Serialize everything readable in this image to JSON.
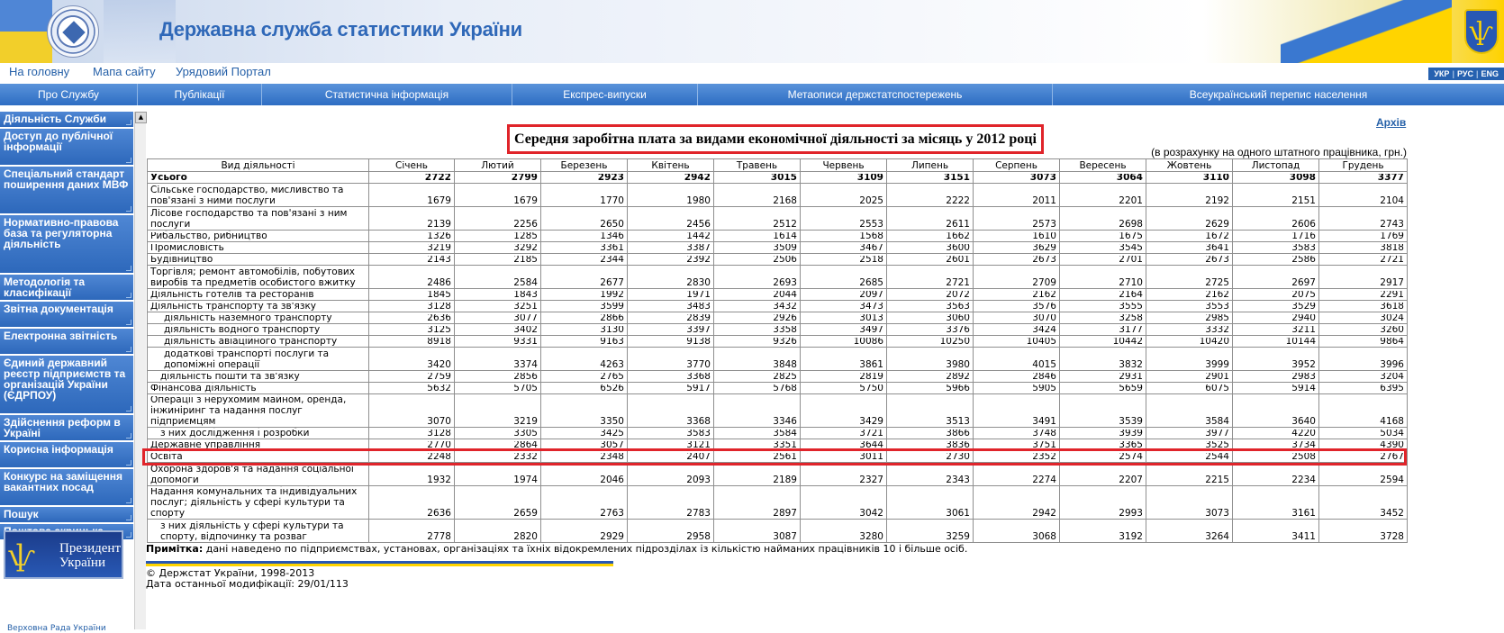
{
  "header": {
    "title": "Державна служба статистики України"
  },
  "toplinks": [
    "На головну",
    "Мапа сайту",
    "Урядовий Портал"
  ],
  "lang": [
    "УКР",
    "РУС",
    "ENG"
  ],
  "mainnav": [
    "Про Службу",
    "Публікації",
    "Статистична інформація",
    "Експрес-випуски",
    "Метаописи держстатспостережень",
    "Всеукраїнський перепис населення"
  ],
  "sidebar": [
    "Діяльність Служби",
    "Доступ до публічної інформації",
    "Спеціальний стандарт поширення даних МВФ",
    "Нормативно-правова база та регуляторна діяльність",
    "Методологія та класифікації",
    "Звітна документація",
    "Електронна звітність",
    "Єдиний державний реєстр підприємств та організацій України (ЄДРПОУ)",
    "Здійснення реформ в Україні",
    "Корисна інформація",
    "Конкурс на заміщення вакантних посад",
    "Пошук",
    "Поштова скринька"
  ],
  "banner": {
    "line1": "Президент",
    "line2": "України",
    "cut": "Верховна Рада України"
  },
  "archive": "Архів",
  "page_title": "Середня заробітна плата за видами економічної діяльності за місяць у 2012 році",
  "units": "(в розрахунку на одного штатного працівника, грн.)",
  "table": {
    "headers": [
      "Вид діяльності",
      "Січень",
      "Лютий",
      "Березень",
      "Квітень",
      "Травень",
      "Червень",
      "Липень",
      "Серпень",
      "Вересень",
      "Жовтень",
      "Листопад",
      "Грудень"
    ],
    "rows": [
      {
        "label": "Усього",
        "v": [
          2722,
          2799,
          2923,
          2942,
          3015,
          3109,
          3151,
          3073,
          3064,
          3110,
          3098,
          3377
        ]
      },
      {
        "label": "Сільське господарство, мисливство та пов'язані з ними послуги",
        "v": [
          1679,
          1679,
          1770,
          1980,
          2168,
          2025,
          2222,
          2011,
          2201,
          2192,
          2151,
          2104
        ]
      },
      {
        "label": "Лісове господарство та пов'язані з ним послуги",
        "v": [
          2139,
          2256,
          2650,
          2456,
          2512,
          2553,
          2611,
          2573,
          2698,
          2629,
          2606,
          2743
        ]
      },
      {
        "label": "Рибальство, рибництво",
        "v": [
          1326,
          1285,
          1346,
          1442,
          1614,
          1568,
          1662,
          1610,
          1675,
          1672,
          1716,
          1769
        ]
      },
      {
        "label": "Промисловість",
        "v": [
          3219,
          3292,
          3361,
          3387,
          3509,
          3467,
          3600,
          3629,
          3545,
          3641,
          3583,
          3818
        ]
      },
      {
        "label": "Будівництво",
        "v": [
          2143,
          2185,
          2344,
          2392,
          2506,
          2518,
          2601,
          2673,
          2701,
          2673,
          2586,
          2721
        ]
      },
      {
        "label": "Торгівля; ремонт автомобілів, побутових виробів та предметів особистого вжитку",
        "v": [
          2486,
          2584,
          2677,
          2830,
          2693,
          2685,
          2721,
          2709,
          2710,
          2725,
          2697,
          2917
        ]
      },
      {
        "label": "Діяльність готелів та ресторанів",
        "v": [
          1845,
          1843,
          1992,
          1971,
          2044,
          2097,
          2072,
          2162,
          2164,
          2162,
          2075,
          2291
        ]
      },
      {
        "label": "Діяльність транспорту та зв'язку",
        "v": [
          3128,
          3251,
          3599,
          3483,
          3432,
          3473,
          3563,
          3576,
          3555,
          3553,
          3529,
          3618
        ]
      },
      {
        "label": "діяльність наземного транспорту",
        "v": [
          2636,
          3077,
          2866,
          2839,
          2926,
          3013,
          3060,
          3070,
          3258,
          2985,
          2940,
          3024
        ]
      },
      {
        "label": "діяльність водного транспорту",
        "v": [
          3125,
          3402,
          3130,
          3397,
          3358,
          3497,
          3376,
          3424,
          3177,
          3332,
          3211,
          3260
        ]
      },
      {
        "label": "діяльність авіаційного транспорту",
        "v": [
          8918,
          9331,
          9163,
          9138,
          9326,
          10086,
          10250,
          10405,
          10442,
          10420,
          10144,
          9864
        ]
      },
      {
        "label": "додаткові транспорті послуги та допоміжні операції",
        "v": [
          3420,
          3374,
          4263,
          3770,
          3848,
          3861,
          3980,
          4015,
          3832,
          3999,
          3952,
          3996
        ]
      },
      {
        "label": "діяльність пошти та зв'язку",
        "v": [
          2759,
          2856,
          2765,
          3368,
          2825,
          2819,
          2892,
          2846,
          2931,
          2901,
          2983,
          3204
        ]
      },
      {
        "label": "Фінансова діяльність",
        "v": [
          5632,
          5705,
          6526,
          5917,
          5768,
          5750,
          5966,
          5905,
          5659,
          6075,
          5914,
          6395
        ]
      },
      {
        "label": "Операції з нерухомим майном, оренда, інжиніринг та надання послуг підприємцям",
        "v": [
          3070,
          3219,
          3350,
          3368,
          3346,
          3429,
          3513,
          3491,
          3539,
          3584,
          3640,
          4168
        ]
      },
      {
        "label": "з них дослідження і розробки",
        "v": [
          3128,
          3305,
          3425,
          3583,
          3584,
          3721,
          3866,
          3748,
          3939,
          3977,
          4220,
          5034
        ]
      },
      {
        "label": "Державне управління",
        "v": [
          2770,
          2864,
          3057,
          3121,
          3351,
          3644,
          3836,
          3751,
          3365,
          3525,
          3734,
          4390
        ]
      },
      {
        "label": "Освіта",
        "v": [
          2248,
          2332,
          2348,
          2407,
          2561,
          3011,
          2730,
          2352,
          2574,
          2544,
          2508,
          2767
        ]
      },
      {
        "label": "Охорона здоров'я та надання соціальної допомоги",
        "v": [
          1932,
          1974,
          2046,
          2093,
          2189,
          2327,
          2343,
          2274,
          2207,
          2215,
          2234,
          2594
        ]
      },
      {
        "label": "Надання комунальних та індивідуальних послуг; діяльність у сфері культури та спорту",
        "v": [
          2636,
          2659,
          2763,
          2783,
          2897,
          3042,
          3061,
          2942,
          2993,
          3073,
          3161,
          3452
        ]
      },
      {
        "label": "з них діяльність у сфері культури та спорту, відпочинку та розваг",
        "v": [
          2778,
          2820,
          2929,
          2958,
          3087,
          3280,
          3259,
          3068,
          3192,
          3264,
          3411,
          3728
        ]
      }
    ]
  },
  "note": {
    "label": "Примітка:",
    "text": " дані наведено по підприємствах, установах, організаціях та їхніх відокремлених підрозділах із кількістю найманих працівників 10 і більше осіб."
  },
  "footer": {
    "copyright": "© Держстат України, 1998-2013",
    "modified": "Дата останньої модифікації: 29/01/113"
  },
  "colors": {
    "nav_blue": "#2d6dc3",
    "link_blue": "#2560a8",
    "highlight_red": "#e0242a",
    "yellow": "#ffd400"
  }
}
